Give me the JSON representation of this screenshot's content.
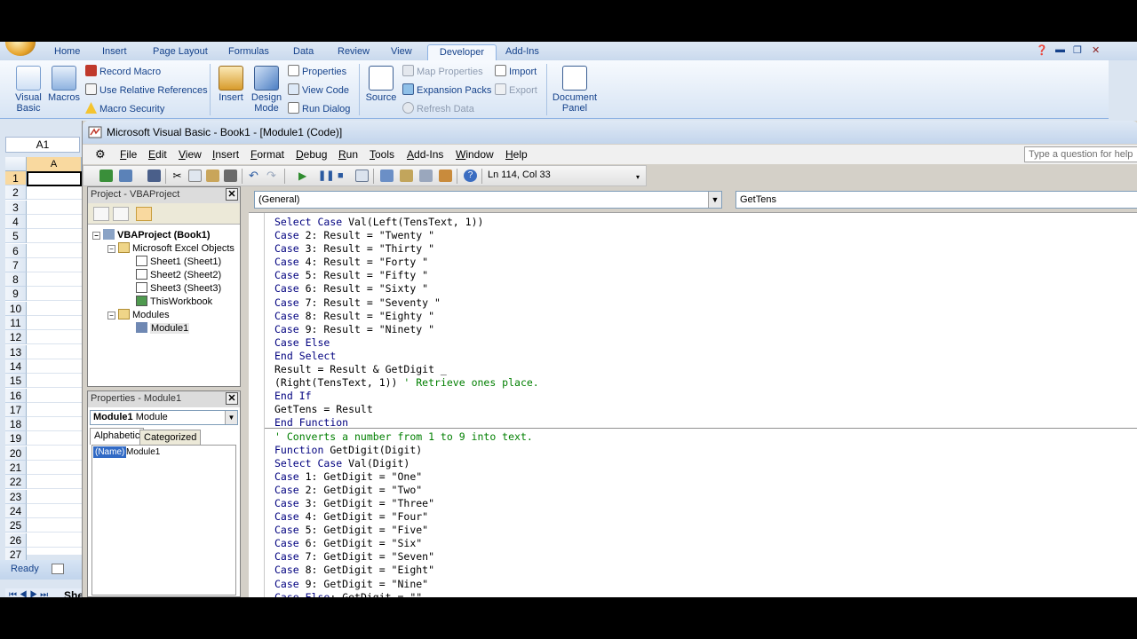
{
  "excel": {
    "tabs": [
      "Home",
      "Insert",
      "Page Layout",
      "Formulas",
      "Data",
      "Review",
      "View",
      "Developer",
      "Add-Ins"
    ],
    "active_tab": "Developer",
    "ribbon": {
      "visual_basic": "Visual\nBasic",
      "macros": "Macros",
      "record_macro": "Record Macro",
      "relative_refs": "Use Relative References",
      "macro_security": "Macro Security",
      "insert": "Insert",
      "design_mode": "Design\nMode",
      "properties": "Properties",
      "view_code": "View Code",
      "run_dialog": "Run Dialog",
      "source": "Source",
      "map_properties": "Map Properties",
      "expansion_packs": "Expansion Packs",
      "refresh_data": "Refresh Data",
      "import": "Import",
      "export": "Export",
      "document_panel": "Document\nPanel"
    },
    "name_box": "A1",
    "column_a": "A",
    "rows": [
      "1",
      "2",
      "3",
      "4",
      "5",
      "6",
      "7",
      "8",
      "9",
      "10",
      "11",
      "12",
      "13",
      "14",
      "15",
      "16",
      "17",
      "18",
      "19",
      "20",
      "21",
      "22",
      "23",
      "24",
      "25",
      "26",
      "27"
    ],
    "sheet_tab": "She",
    "status": "Ready"
  },
  "vbe": {
    "title": "Microsoft Visual Basic - Book1 - [Module1 (Code)]",
    "menu": [
      {
        "label": "File",
        "u": "F",
        "rest": "ile"
      },
      {
        "label": "Edit",
        "u": "E",
        "rest": "dit"
      },
      {
        "label": "View",
        "u": "V",
        "rest": "iew"
      },
      {
        "label": "Insert",
        "u": "I",
        "rest": "nsert"
      },
      {
        "label": "Format",
        "u": "F",
        "rest": "ormat"
      },
      {
        "label": "Debug",
        "u": "D",
        "rest": "ebug"
      },
      {
        "label": "Run",
        "u": "R",
        "rest": "un"
      },
      {
        "label": "Tools",
        "u": "T",
        "rest": "ools"
      },
      {
        "label": "Add-Ins",
        "u": "A",
        "rest": "dd-Ins"
      },
      {
        "label": "Window",
        "u": "W",
        "rest": "indow"
      },
      {
        "label": "Help",
        "u": "H",
        "rest": "elp"
      }
    ],
    "help_placeholder": "Type a question for help",
    "cursor_pos": "Ln 114, Col 33",
    "project": {
      "title": "Project - VBAProject",
      "root": "VBAProject (Book1)",
      "objects_folder": "Microsoft Excel Objects",
      "sheets": [
        "Sheet1 (Sheet1)",
        "Sheet2 (Sheet2)",
        "Sheet3 (Sheet3)",
        "ThisWorkbook"
      ],
      "modules_folder": "Modules",
      "module": "Module1"
    },
    "properties": {
      "title": "Properties - Module1",
      "object_bold": "Module1",
      "object_type": "Module",
      "tab_alpha": "Alphabetic",
      "tab_cat": "Categorized",
      "name_key": "(Name)",
      "name_val": "Module1"
    },
    "code": {
      "object_combo": "(General)",
      "proc_combo": "GetTens",
      "lines": [
        {
          "k": "",
          "t": "Select Case Val(Left(TensText, 1))",
          "c": ""
        },
        {
          "k": "",
          "t": "Case 2: Result = \"Twenty \"",
          "c": ""
        },
        {
          "k": "",
          "t": "Case 3: Result = \"Thirty \"",
          "c": ""
        },
        {
          "k": "",
          "t": "Case 4: Result = \"Forty \"",
          "c": ""
        },
        {
          "k": "",
          "t": "Case 5: Result = \"Fifty \"",
          "c": ""
        },
        {
          "k": "",
          "t": "Case 6: Result = \"Sixty \"",
          "c": ""
        },
        {
          "k": "",
          "t": "Case 7: Result = \"Seventy \"",
          "c": ""
        },
        {
          "k": "",
          "t": "Case 8: Result = \"Eighty \"",
          "c": ""
        },
        {
          "k": "",
          "t": "Case 9: Result = \"Ninety \"",
          "c": ""
        },
        {
          "k": "",
          "t": "Case Else",
          "c": ""
        },
        {
          "k": "",
          "t": "End Select",
          "c": ""
        },
        {
          "k": "",
          "t": "Result = Result & GetDigit _",
          "c": ""
        },
        {
          "k": "",
          "t": "(Right(TensText, 1)) ",
          "c": "' Retrieve ones place."
        },
        {
          "k": "",
          "t": "End If",
          "c": ""
        },
        {
          "k": "",
          "t": "GetTens = Result",
          "c": ""
        },
        {
          "k": "",
          "t": "End Function",
          "c": ""
        },
        {
          "k": "",
          "t": "",
          "c": "' Converts a number from 1 to 9 into text."
        },
        {
          "k": "",
          "t": "Function GetDigit(Digit)",
          "c": ""
        },
        {
          "k": "",
          "t": "Select Case Val(Digit)",
          "c": ""
        },
        {
          "k": "",
          "t": "Case 1: GetDigit = \"One\"",
          "c": ""
        },
        {
          "k": "",
          "t": "Case 2: GetDigit = \"Two\"",
          "c": ""
        },
        {
          "k": "",
          "t": "Case 3: GetDigit = \"Three\"",
          "c": ""
        },
        {
          "k": "",
          "t": "Case 4: GetDigit = \"Four\"",
          "c": ""
        },
        {
          "k": "",
          "t": "Case 5: GetDigit = \"Five\"",
          "c": ""
        },
        {
          "k": "",
          "t": "Case 6: GetDigit = \"Six\"",
          "c": ""
        },
        {
          "k": "",
          "t": "Case 7: GetDigit = \"Seven\"",
          "c": ""
        },
        {
          "k": "",
          "t": "Case 8: GetDigit = \"Eight\"",
          "c": ""
        },
        {
          "k": "",
          "t": "Case 9: GetDigit = \"Nine\"",
          "c": ""
        },
        {
          "k": "",
          "t": "Case Else: GetDigit = \"\"",
          "c": ""
        }
      ]
    }
  },
  "colors": {
    "keyword": "#00007f",
    "comment": "#007f00",
    "ribbon_text": "#15428b",
    "selection": "#316ac5"
  }
}
